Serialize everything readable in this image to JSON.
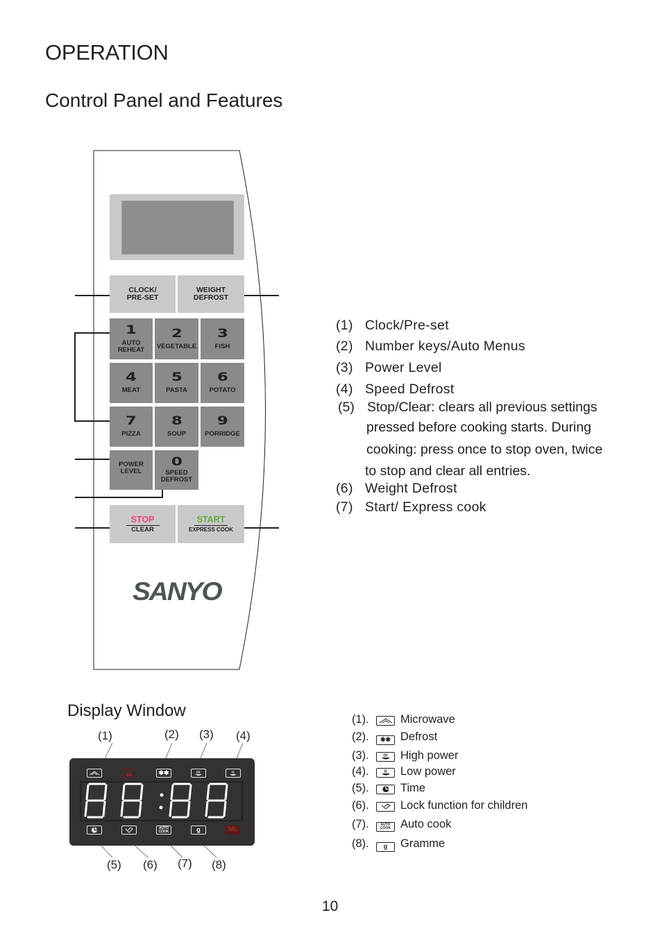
{
  "header": {
    "title": "OPERATION",
    "subtitle": "Control Panel and Features"
  },
  "control_panel": {
    "keys": {
      "clock": {
        "line1": "CLOCK/",
        "line2": "PRE-SET"
      },
      "weight_defrost": {
        "line1": "WEIGHT",
        "line2": "DEFROST"
      },
      "number_keys": [
        {
          "num": "1",
          "label1": "AUTO",
          "label2": "REHEAT"
        },
        {
          "num": "2",
          "label1": "VEGETABLE",
          "label2": ""
        },
        {
          "num": "3",
          "label1": "FISH",
          "label2": ""
        },
        {
          "num": "4",
          "label1": "MEAT",
          "label2": ""
        },
        {
          "num": "5",
          "label1": "PASTA",
          "label2": ""
        },
        {
          "num": "6",
          "label1": "POTATO",
          "label2": ""
        },
        {
          "num": "7",
          "label1": "PIZZA",
          "label2": ""
        },
        {
          "num": "8",
          "label1": "SOUP",
          "label2": ""
        },
        {
          "num": "9",
          "label1": "PORRIDGE",
          "label2": ""
        }
      ],
      "power_level": {
        "line1": "POWER",
        "line2": "LEVEL"
      },
      "speed_defrost": {
        "num": "0",
        "line1": "SPEED",
        "line2": "DEFROST"
      },
      "stop": {
        "top": "STOP",
        "bottom": "CLEAR"
      },
      "start": {
        "top": "START",
        "bottom": "EXPRESS COOK"
      }
    },
    "brand": "SANYO",
    "colors": {
      "stop": "#e8457a",
      "start": "#5fae3f",
      "key_light": "#c9c9c9",
      "key_dark": "#8a8b88"
    }
  },
  "features": [
    {
      "n": "(1)",
      "text": "Clock/Pre-set"
    },
    {
      "n": "(2)",
      "text": "Number keys/Auto Menus"
    },
    {
      "n": "(3)",
      "text": "Power Level"
    },
    {
      "n": "(4)",
      "text": "Speed Defrost"
    },
    {
      "n": "(5)",
      "lines": [
        "Stop/Clear: clears all previous settings",
        "pressed before cooking starts. During",
        "cooking: press once to stop oven, twice",
        "to stop and clear all entries."
      ]
    },
    {
      "n": "(6)",
      "text": "Weight Defrost"
    },
    {
      "n": "(7)",
      "text": "Start/ Express cook"
    }
  ],
  "display_window": {
    "title": "Display  Window",
    "top_callouts": [
      "(1)",
      "(2)",
      "(3)",
      "(4)"
    ],
    "bottom_callouts": [
      "(5)",
      "(6)",
      "(7)",
      "(8)"
    ],
    "digits": "88:88",
    "indicators_top": [
      "microwave-icon",
      "grill-icon",
      "defrost-icon",
      "high-power-icon",
      "low-power-icon"
    ],
    "indicators_bottom": [
      "time-icon",
      "child-lock-icon",
      "auto-cook-icon",
      "gramme-icon",
      "ml-icon"
    ],
    "auto_cook_text": [
      "AUTO",
      "COOK"
    ],
    "gramme_text": "g",
    "ml_text": "ML",
    "legend": [
      {
        "n": "(1).",
        "icon": "microwave-icon",
        "text": "Microwave"
      },
      {
        "n": "(2).",
        "icon": "defrost-icon",
        "text": "Defrost"
      },
      {
        "n": "(3).",
        "icon": "high-power-icon",
        "text": "High power"
      },
      {
        "n": "(4).",
        "icon": "low-power-icon",
        "text": "Low power"
      },
      {
        "n": "(5).",
        "icon": "time-icon",
        "text": "Time"
      },
      {
        "n": "(6).",
        "icon": "child-lock-icon",
        "text": "Lock function for children"
      },
      {
        "n": "(7).",
        "icon": "auto-cook-icon",
        "text": "Auto cook"
      },
      {
        "n": "(8).",
        "icon": "gramme-icon",
        "text": "Gramme"
      }
    ]
  },
  "page_number": "10"
}
